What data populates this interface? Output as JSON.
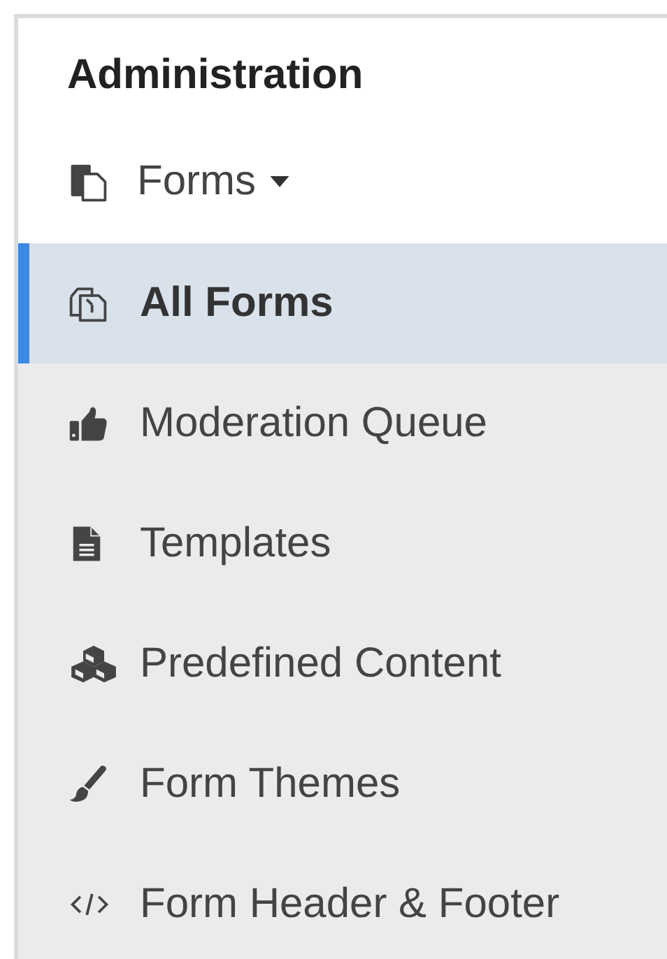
{
  "sidebar": {
    "heading": "Administration",
    "section": {
      "label": "Forms",
      "expanded": true
    },
    "items": [
      {
        "label": "All Forms",
        "selected": true
      },
      {
        "label": "Moderation Queue",
        "selected": false
      },
      {
        "label": "Templates",
        "selected": false
      },
      {
        "label": "Predefined Content",
        "selected": false
      },
      {
        "label": "Form Themes",
        "selected": false
      },
      {
        "label": "Form Header & Footer",
        "selected": false
      }
    ]
  }
}
